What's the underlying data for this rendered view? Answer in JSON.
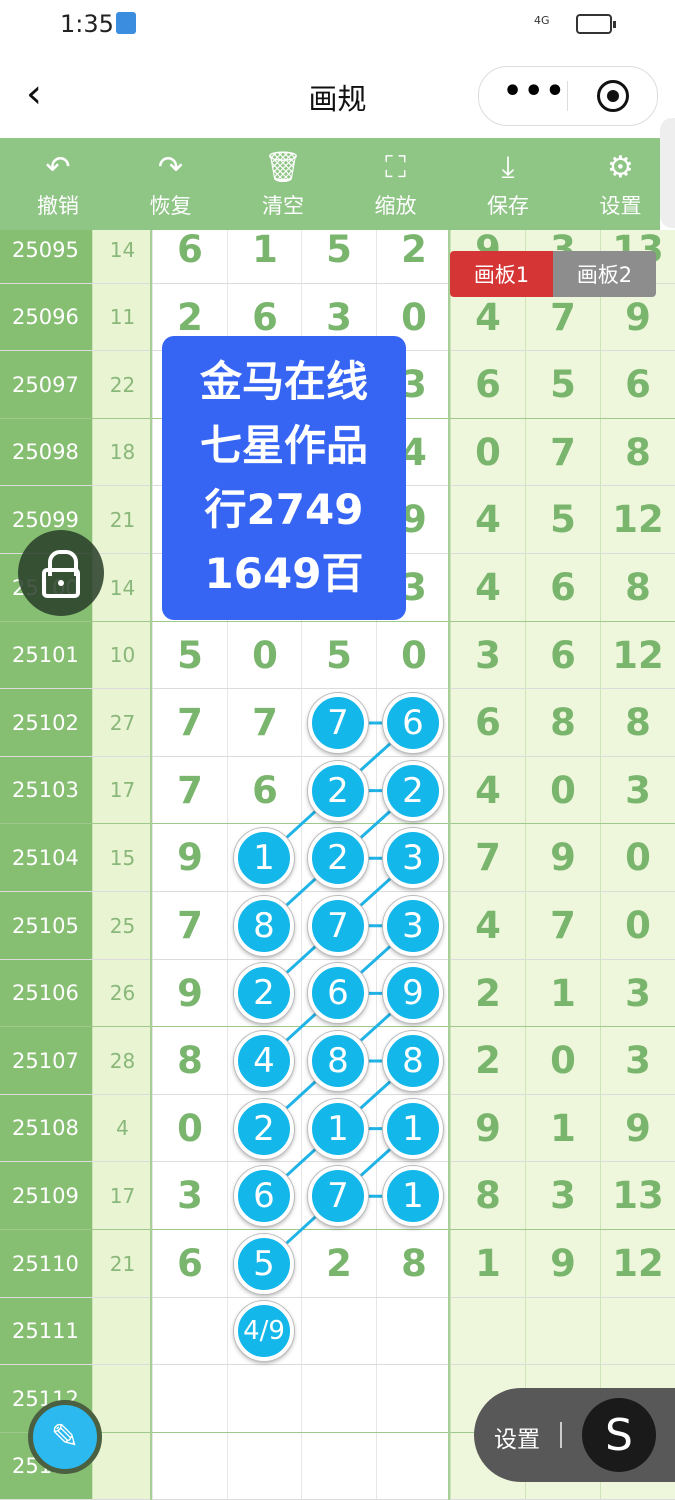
{
  "status": {
    "time": "1:35",
    "network": "4G"
  },
  "nav": {
    "title": "画规",
    "back_icon": "chevron-left-icon",
    "menu_icon": "more-dots-icon",
    "close_icon": "target-icon"
  },
  "toolbar": [
    {
      "label": "撤销",
      "icon": "undo-icon",
      "glyph": "↶"
    },
    {
      "label": "恢复",
      "icon": "redo-icon",
      "glyph": "↷"
    },
    {
      "label": "清空",
      "icon": "trash-icon",
      "glyph": "🗑"
    },
    {
      "label": "缩放",
      "icon": "zoom-icon",
      "glyph": "⛶"
    },
    {
      "label": "保存",
      "icon": "download-icon",
      "glyph": "⤓"
    },
    {
      "label": "设置",
      "icon": "gear-icon",
      "glyph": "⚙"
    }
  ],
  "tabs": {
    "board1": "画板1",
    "board2": "画板2"
  },
  "overlay": {
    "lines": [
      "金马在线",
      "七星作品",
      "行2749",
      "1649百"
    ]
  },
  "rows": [
    {
      "id": "25095",
      "sum": "14",
      "d": [
        "6",
        "1",
        "5",
        "2"
      ],
      "e": [
        "9",
        "3",
        "13"
      ]
    },
    {
      "id": "25096",
      "sum": "11",
      "d": [
        "2",
        "6",
        "3",
        "0"
      ],
      "e": [
        "4",
        "7",
        "9"
      ]
    },
    {
      "id": "25097",
      "sum": "22",
      "d": [
        "",
        "",
        "",
        "3"
      ],
      "e": [
        "6",
        "5",
        "6"
      ]
    },
    {
      "id": "25098",
      "sum": "18",
      "d": [
        "",
        "",
        "",
        "4"
      ],
      "e": [
        "0",
        "7",
        "8"
      ]
    },
    {
      "id": "25099",
      "sum": "21",
      "d": [
        "",
        "",
        "",
        "9"
      ],
      "e": [
        "4",
        "5",
        "12"
      ]
    },
    {
      "id": "25100",
      "sum": "14",
      "d": [
        "",
        "",
        "",
        "3"
      ],
      "e": [
        "4",
        "6",
        "8"
      ]
    },
    {
      "id": "25101",
      "sum": "10",
      "d": [
        "5",
        "0",
        "5",
        "0"
      ],
      "e": [
        "3",
        "6",
        "12"
      ]
    },
    {
      "id": "25102",
      "sum": "27",
      "d": [
        "7",
        "7",
        "7",
        "6"
      ],
      "e": [
        "6",
        "8",
        "8"
      ]
    },
    {
      "id": "25103",
      "sum": "17",
      "d": [
        "7",
        "6",
        "2",
        "2"
      ],
      "e": [
        "4",
        "0",
        "3"
      ]
    },
    {
      "id": "25104",
      "sum": "15",
      "d": [
        "9",
        "1",
        "2",
        "3"
      ],
      "e": [
        "7",
        "9",
        "0"
      ]
    },
    {
      "id": "25105",
      "sum": "25",
      "d": [
        "7",
        "8",
        "7",
        "3"
      ],
      "e": [
        "4",
        "7",
        "0"
      ]
    },
    {
      "id": "25106",
      "sum": "26",
      "d": [
        "9",
        "2",
        "6",
        "9"
      ],
      "e": [
        "2",
        "1",
        "3"
      ]
    },
    {
      "id": "25107",
      "sum": "28",
      "d": [
        "8",
        "4",
        "8",
        "8"
      ],
      "e": [
        "2",
        "0",
        "3"
      ]
    },
    {
      "id": "25108",
      "sum": "4",
      "d": [
        "0",
        "2",
        "1",
        "1"
      ],
      "e": [
        "9",
        "1",
        "9"
      ]
    },
    {
      "id": "25109",
      "sum": "17",
      "d": [
        "3",
        "6",
        "7",
        "1"
      ],
      "e": [
        "8",
        "3",
        "13"
      ]
    },
    {
      "id": "25110",
      "sum": "21",
      "d": [
        "6",
        "5",
        "2",
        "8"
      ],
      "e": [
        "1",
        "9",
        "12"
      ]
    },
    {
      "id": "25111",
      "sum": "",
      "d": [
        "",
        "",
        "",
        ""
      ],
      "e": [
        "",
        "",
        ""
      ]
    },
    {
      "id": "25112",
      "sum": "",
      "d": [
        "",
        "",
        "",
        ""
      ],
      "e": [
        "",
        "",
        ""
      ]
    },
    {
      "id": "25113",
      "sum": "",
      "d": [
        "",
        "",
        "",
        ""
      ],
      "e": [
        "",
        "",
        ""
      ]
    }
  ],
  "balls": [
    {
      "row": 7,
      "col": 2,
      "v": "7"
    },
    {
      "row": 7,
      "col": 3,
      "v": "6"
    },
    {
      "row": 8,
      "col": 2,
      "v": "2"
    },
    {
      "row": 8,
      "col": 3,
      "v": "2"
    },
    {
      "row": 9,
      "col": 1,
      "v": "1"
    },
    {
      "row": 9,
      "col": 2,
      "v": "2"
    },
    {
      "row": 9,
      "col": 3,
      "v": "3"
    },
    {
      "row": 10,
      "col": 1,
      "v": "8"
    },
    {
      "row": 10,
      "col": 2,
      "v": "7"
    },
    {
      "row": 10,
      "col": 3,
      "v": "3"
    },
    {
      "row": 11,
      "col": 1,
      "v": "2"
    },
    {
      "row": 11,
      "col": 2,
      "v": "6"
    },
    {
      "row": 11,
      "col": 3,
      "v": "9"
    },
    {
      "row": 12,
      "col": 1,
      "v": "4"
    },
    {
      "row": 12,
      "col": 2,
      "v": "8"
    },
    {
      "row": 12,
      "col": 3,
      "v": "8"
    },
    {
      "row": 13,
      "col": 1,
      "v": "2"
    },
    {
      "row": 13,
      "col": 2,
      "v": "1"
    },
    {
      "row": 13,
      "col": 3,
      "v": "1"
    },
    {
      "row": 14,
      "col": 1,
      "v": "6"
    },
    {
      "row": 14,
      "col": 2,
      "v": "7"
    },
    {
      "row": 14,
      "col": 3,
      "v": "1"
    },
    {
      "row": 15,
      "col": 1,
      "v": "5"
    },
    {
      "row": 16,
      "col": 1,
      "v": "4/9"
    }
  ],
  "floating": {
    "settings_label": "设置",
    "s_button": "S",
    "lock_icon": "lock-icon",
    "pen_icon": "pen-icon"
  }
}
